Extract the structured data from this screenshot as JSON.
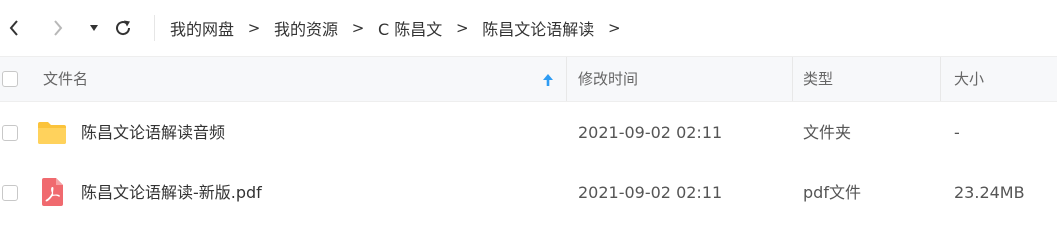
{
  "toolbar": {
    "back_icon": "chevron-left-icon",
    "forward_icon": "chevron-right-icon",
    "history_icon": "caret-down-icon",
    "refresh_icon": "refresh-icon"
  },
  "breadcrumb": {
    "items": [
      "我的网盘",
      "我的资源",
      "C 陈昌文",
      "陈昌文论语解读"
    ],
    "separator": ">"
  },
  "table": {
    "columns": {
      "name": "文件名",
      "modified": "修改时间",
      "type": "类型",
      "size": "大小"
    },
    "sort_icon": "arrow-up-icon",
    "rows": [
      {
        "name": "陈昌文论语解读音频",
        "modified": "2021-09-02 02:11",
        "type": "文件夹",
        "size": "-",
        "icon": "folder-icon"
      },
      {
        "name": "陈昌文论语解读-新版.pdf",
        "modified": "2021-09-02 02:11",
        "type": "pdf文件",
        "size": "23.24MB",
        "icon": "pdf-file-icon"
      }
    ]
  },
  "colors": {
    "accent": "#2e9cf3",
    "folder": "#fbc33b",
    "pdf": "#f06a6f",
    "header_bg": "#f7f8fa"
  }
}
